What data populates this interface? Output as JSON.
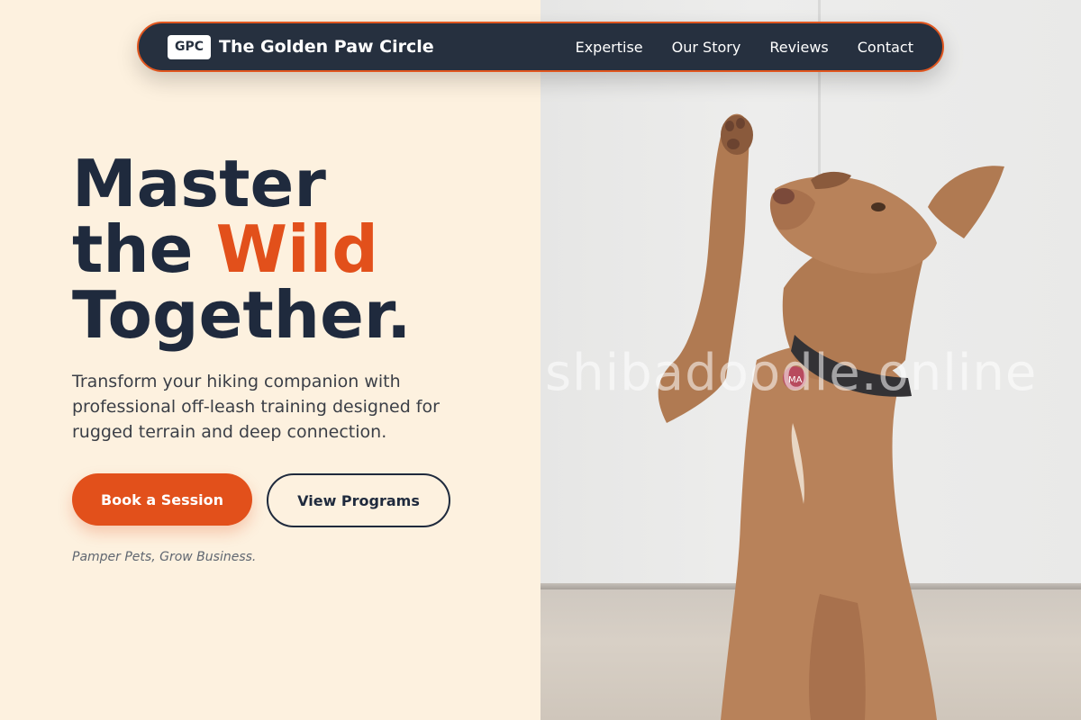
{
  "nav": {
    "logo_badge": "GPC",
    "brand": "The Golden Paw Circle",
    "links": [
      "Expertise",
      "Our Story",
      "Reviews",
      "Contact"
    ]
  },
  "hero": {
    "title_line1": "Master",
    "title_line2_pre": "the ",
    "title_line2_accent": "Wild",
    "title_line3": "Together.",
    "subtitle": "Transform your hiking companion with professional off-leash training designed for rugged terrain and deep connection.",
    "cta_primary": "Book a Session",
    "cta_secondary": "View Programs",
    "tagline": "Pamper Pets, Grow Business."
  },
  "image": {
    "watermark": "shibadoodle.online",
    "subject": "dog-raising-paw-photo"
  },
  "colors": {
    "background": "#fdf1df",
    "nav_bg": "#26303f",
    "accent": "#e2501b",
    "heading": "#1f2a3d"
  }
}
